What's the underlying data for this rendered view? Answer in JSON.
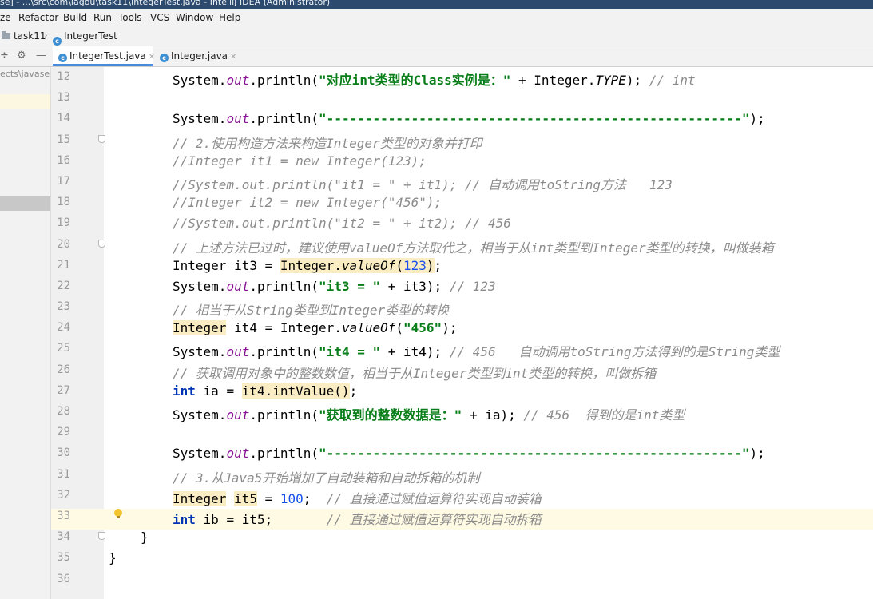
{
  "window": {
    "title": "se] - ...\\src\\com\\lagou\\task11\\IntegerTest.java - IntelliJ IDEA (Administrator)"
  },
  "menu": {
    "items": [
      "ze",
      "Refactor",
      "Build",
      "Run",
      "Tools",
      "VCS",
      "Window",
      "Help"
    ]
  },
  "nav": {
    "folder": "task11",
    "file": "IntegerTest"
  },
  "tabs": [
    {
      "label": "IntegerTest.java",
      "active": true
    },
    {
      "label": "Integer.java",
      "active": false
    }
  ],
  "project": {
    "path": "ects\\javase"
  },
  "icons": {
    "class": "class-icon",
    "folder": "folder-icon",
    "settings": "gear-icon",
    "minimize": "minus-icon",
    "bulb": "lightbulb-icon"
  },
  "colors": {
    "keyword": "#0033b3",
    "string": "#067d17",
    "comment": "#8c8c8c",
    "field": "#871094",
    "number": "#1750eb",
    "caret_line": "#fffae3"
  },
  "editor": {
    "caret_line": 33,
    "lines": [
      {
        "n": "12",
        "tokens": [
          [
            "",
            "System."
          ],
          [
            "fd",
            "out"
          ],
          [
            "",
            ".println("
          ],
          [
            "st",
            "\"对应int类型的Class实例是：\""
          ],
          [
            "",
            " + Integer."
          ],
          [
            "it",
            "TYPE"
          ],
          [
            "",
            "); "
          ],
          [
            "cm",
            "// int"
          ]
        ]
      },
      {
        "n": "13",
        "tokens": []
      },
      {
        "n": "14",
        "tokens": [
          [
            "",
            "System."
          ],
          [
            "fd",
            "out"
          ],
          [
            "",
            ".println("
          ],
          [
            "st",
            "\"------------------------------------------------------\""
          ],
          [
            "",
            ");"
          ]
        ]
      },
      {
        "n": "15",
        "fold": true,
        "tokens": [
          [
            "cm",
            "// 2.使用构造方法来构造Integer类型的对象并打印"
          ]
        ]
      },
      {
        "n": "16",
        "tokens": [
          [
            "cm",
            "//Integer it1 = new Integer(123);"
          ]
        ]
      },
      {
        "n": "17",
        "tokens": [
          [
            "cm",
            "//System.out.println(\"it1 = \" + it1); // 自动调用toString方法   123"
          ]
        ]
      },
      {
        "n": "18",
        "tokens": [
          [
            "cm",
            "//Integer it2 = new Integer(\"456\");"
          ]
        ]
      },
      {
        "n": "19",
        "tokens": [
          [
            "cm",
            "//System.out.println(\"it2 = \" + it2); // 456"
          ]
        ]
      },
      {
        "n": "20",
        "fold": true,
        "tokens": [
          [
            "cm",
            "// 上述方法已过时，建议使用valueOf方法取代之，相当于从int类型到Integer类型的转换，叫做装箱"
          ]
        ]
      },
      {
        "n": "21",
        "tokens": [
          [
            "",
            "Integer it3 = "
          ],
          [
            "hl",
            "Integer."
          ],
          [
            "hl it",
            "valueOf"
          ],
          [
            "hl",
            "("
          ],
          [
            "hl nm",
            "123"
          ],
          [
            "hl",
            ")"
          ],
          [
            "",
            ";"
          ]
        ]
      },
      {
        "n": "22",
        "tokens": [
          [
            "",
            "System."
          ],
          [
            "fd",
            "out"
          ],
          [
            "",
            ".println("
          ],
          [
            "st",
            "\"it3 = \""
          ],
          [
            "",
            " + it3); "
          ],
          [
            "cm",
            "// 123"
          ]
        ]
      },
      {
        "n": "23",
        "tokens": [
          [
            "cm",
            "// 相当于从String类型到Integer类型的转换"
          ]
        ]
      },
      {
        "n": "24",
        "tokens": [
          [
            "hl",
            "Integer"
          ],
          [
            "",
            " it4 = Integer."
          ],
          [
            "it",
            "valueOf"
          ],
          [
            "",
            "("
          ],
          [
            "st",
            "\"456\""
          ],
          [
            "",
            ");"
          ]
        ]
      },
      {
        "n": "25",
        "tokens": [
          [
            "",
            "System."
          ],
          [
            "fd",
            "out"
          ],
          [
            "",
            ".println("
          ],
          [
            "st",
            "\"it4 = \""
          ],
          [
            "",
            " + it4); "
          ],
          [
            "cm",
            "// 456   自动调用toString方法得到的是String类型"
          ]
        ]
      },
      {
        "n": "26",
        "tokens": [
          [
            "cm",
            "// 获取调用对象中的整数数值，相当于从Integer类型到int类型的转换，叫做拆箱"
          ]
        ]
      },
      {
        "n": "27",
        "tokens": [
          [
            "kw",
            "int"
          ],
          [
            "",
            " ia = "
          ],
          [
            "hl",
            "it4.intValue()"
          ],
          [
            "",
            ";"
          ]
        ]
      },
      {
        "n": "28",
        "tokens": [
          [
            "",
            "System."
          ],
          [
            "fd",
            "out"
          ],
          [
            "",
            ".println("
          ],
          [
            "st",
            "\"获取到的整数数据是：\""
          ],
          [
            "",
            " + ia); "
          ],
          [
            "cm",
            "// 456  得到的是int类型"
          ]
        ]
      },
      {
        "n": "29",
        "tokens": []
      },
      {
        "n": "30",
        "tokens": [
          [
            "",
            "System."
          ],
          [
            "fd",
            "out"
          ],
          [
            "",
            ".println("
          ],
          [
            "st",
            "\"------------------------------------------------------\""
          ],
          [
            "",
            ");"
          ]
        ]
      },
      {
        "n": "31",
        "tokens": [
          [
            "cm",
            "// 3.从Java5开始增加了自动装箱和自动拆箱的机制"
          ]
        ]
      },
      {
        "n": "32",
        "tokens": [
          [
            "hl",
            "Integer"
          ],
          [
            "",
            " "
          ],
          [
            "hl",
            "it5"
          ],
          [
            "",
            " = "
          ],
          [
            "nm",
            "100"
          ],
          [
            "",
            ";  "
          ],
          [
            "cm",
            "// 直接通过赋值运算符实现自动装箱"
          ]
        ]
      },
      {
        "n": "33",
        "bulb": true,
        "tokens": [
          [
            "kw",
            "int"
          ],
          [
            "",
            " ib = it5;       "
          ],
          [
            "cm",
            "// 直接通过赋值运算符实现自动拆箱"
          ]
        ]
      },
      {
        "n": "34",
        "fold": true,
        "indent": "close1",
        "tokens": [
          [
            "",
            "}"
          ]
        ]
      },
      {
        "n": "35",
        "indent": "close2",
        "tokens": [
          [
            "",
            "}"
          ]
        ]
      },
      {
        "n": "36",
        "tokens": []
      }
    ]
  }
}
